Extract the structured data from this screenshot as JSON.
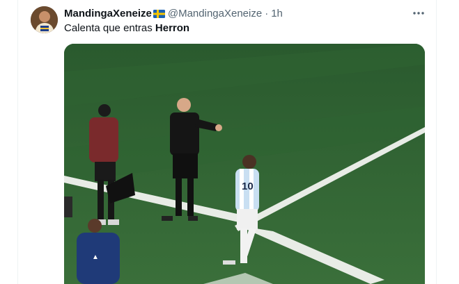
{
  "tweet": {
    "display_name": "MandingaXeneize",
    "handle": "@MandingaXeneize",
    "separator": "·",
    "time": "1h",
    "text_prefix": "Calenta que entras ",
    "text_bold": "Herron",
    "flag_icon": "sweden-flag-icon",
    "more_icon": "more-options-icon"
  },
  "media": {
    "kind": "video-frame",
    "description_icon": "soccer-substitution-photo",
    "jersey_number": "10"
  },
  "colors": {
    "text_primary": "#0f1419",
    "text_secondary": "#536471",
    "pitch": "#2f5f33"
  }
}
